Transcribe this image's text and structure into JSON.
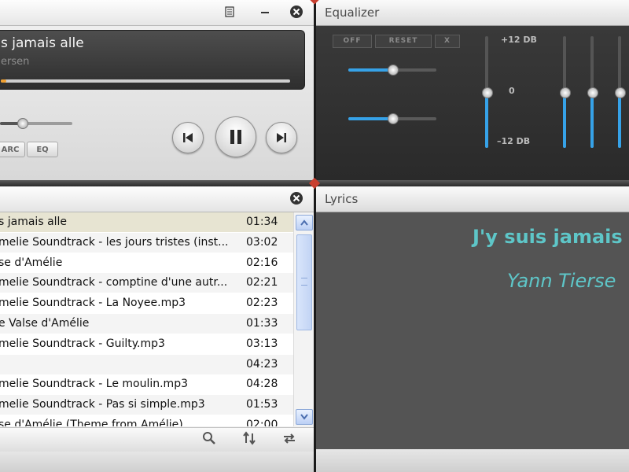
{
  "player": {
    "song_title": "s jamais alle",
    "artist": "ersen",
    "progress": 0.02,
    "volume": 0.28,
    "arc_label": "ARC",
    "eq_label": "EQ"
  },
  "equalizer": {
    "title": "Equalizer",
    "off_label": "OFF",
    "reset_label": "RESET",
    "x_label": "X",
    "label_top": "+12 DB",
    "label_mid": "0",
    "label_bottom": "–12 DB",
    "horizontal_sliders": [
      0.5,
      0.5
    ],
    "band_levels": [
      0.5,
      0.5,
      0.5,
      0.5
    ]
  },
  "playlist": {
    "tracks": [
      {
        "title": "s jamais alle",
        "duration": "01:34"
      },
      {
        "title": "melie Soundtrack - les jours tristes (inst...",
        "duration": "03:02"
      },
      {
        "title": "se d'Amélie",
        "duration": "02:16"
      },
      {
        "title": "melie Soundtrack - comptine d'une autr...",
        "duration": "02:21"
      },
      {
        "title": "melie Soundtrack - La Noyee.mp3",
        "duration": "02:23"
      },
      {
        "title": "e Valse d'Amélie",
        "duration": "01:33"
      },
      {
        "title": "melie Soundtrack - Guilty.mp3",
        "duration": "03:13"
      },
      {
        "title": "",
        "duration": "04:23"
      },
      {
        "title": "melie Soundtrack - Le moulin.mp3",
        "duration": "04:28"
      },
      {
        "title": "melie Soundtrack - Pas si simple.mp3",
        "duration": "01:53"
      },
      {
        "title": "se d'Amélie (Theme from Amélie)",
        "duration": "02:00"
      }
    ]
  },
  "lyrics": {
    "title": "Lyrics",
    "song": "J'y suis jamais",
    "artist": "Yann Tierse"
  }
}
